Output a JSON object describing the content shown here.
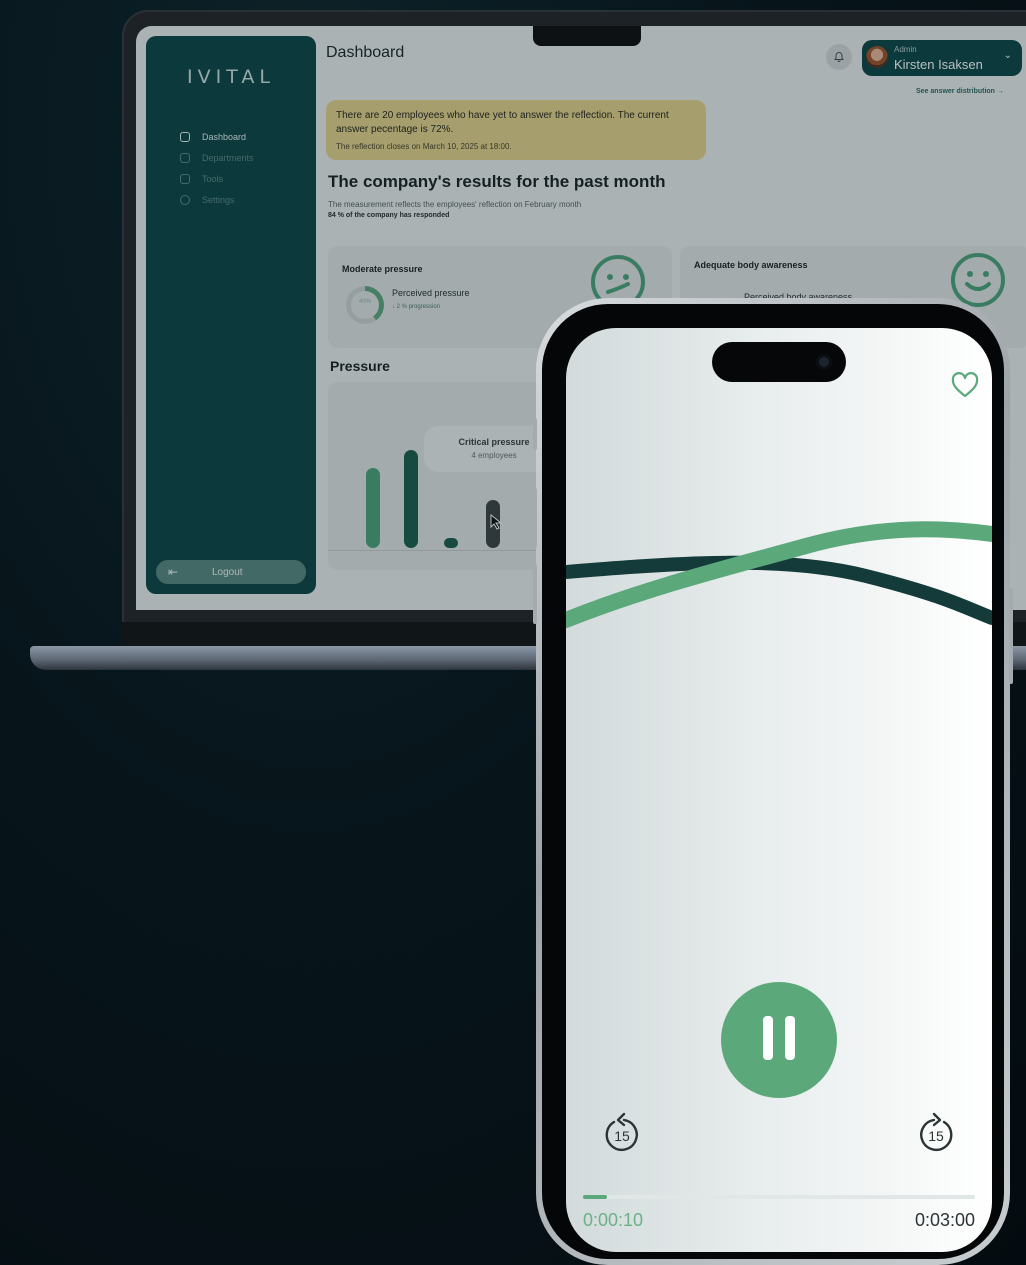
{
  "dashboard": {
    "logo": "IVITAL",
    "page_title": "Dashboard",
    "nav": [
      {
        "label": "Dashboard",
        "icon": "home-icon",
        "active": true
      },
      {
        "label": "Departments",
        "icon": "departments-icon",
        "active": false
      },
      {
        "label": "Tools",
        "icon": "tools-icon",
        "active": false
      },
      {
        "label": "Settings",
        "icon": "settings-icon",
        "active": false
      }
    ],
    "logout_label": "Logout",
    "user": {
      "role": "Admin",
      "name": "Kirsten Isaksen"
    },
    "see_link": "See answer distribution →",
    "alert": {
      "text": "There are 20 employees who have yet to answer the reflection. The current answer pecentage is 72%.",
      "sub": "The reflection closes on March 10, 2025 at 18:00."
    },
    "results": {
      "title": "The company's results for the past month",
      "subtitle": "The measurement reflects the employees' reflection on February month",
      "subtitle2": "84 % of the company has responded"
    },
    "cards": [
      {
        "title": "Moderate pressure",
        "metric": "Perceived pressure",
        "percent_label": "40%",
        "percent": 40,
        "progression": "↓ 2 % progression"
      },
      {
        "title": "Adequate body awareness",
        "metric": "Perceived body awareness"
      }
    ],
    "pressure_section": "Pressure",
    "tooltip": {
      "title": "Critical pressure",
      "sub": "4 employees"
    },
    "colors": {
      "sidebar": "#10484a",
      "accent_green": "#5fa882",
      "alert": "#e6d38e"
    }
  },
  "player": {
    "time_current": "0:00:10",
    "time_total": "0:03:00",
    "progress_fraction": 0.06,
    "skip_back_label": "15",
    "skip_forward_label": "15",
    "colors": {
      "accent": "#5ba97b",
      "dark_wave": "#153a3a"
    }
  }
}
